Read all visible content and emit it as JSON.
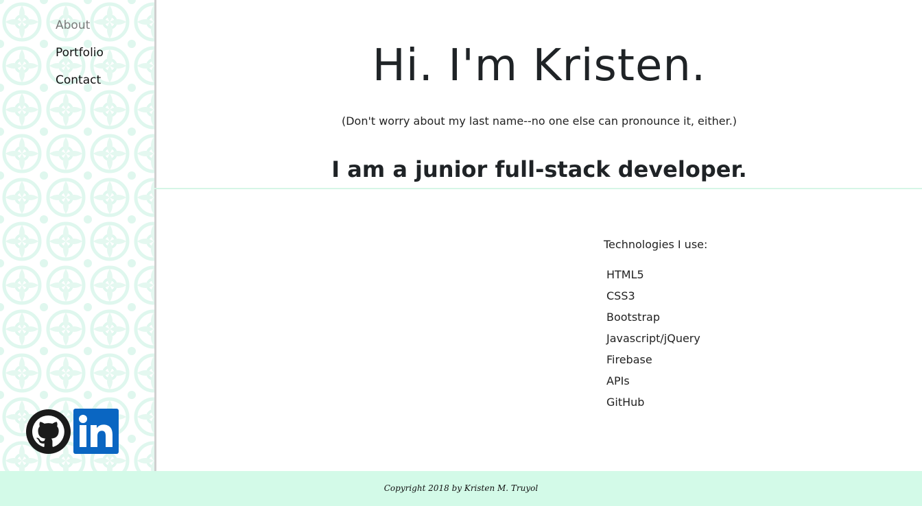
{
  "sidebar": {
    "nav": [
      {
        "label": "About",
        "active": true
      },
      {
        "label": "Portfolio",
        "active": false
      },
      {
        "label": "Contact",
        "active": false
      }
    ],
    "social": [
      {
        "icon": "github-icon"
      },
      {
        "icon": "linkedin-icon"
      }
    ]
  },
  "hero": {
    "title": "Hi. I'm Kristen.",
    "subtitle": "(Don't worry about my last name--no one else can pronounce it, either.)",
    "role": "I am a junior full-stack developer."
  },
  "technologies": {
    "heading": "Technologies I use:",
    "items": [
      "HTML5",
      "CSS3",
      "Bootstrap",
      "Javascript/jQuery",
      "Firebase",
      "APIs",
      "GitHub"
    ]
  },
  "footer": {
    "copyright": "Copyright 2018 by Kristen M. Truyol"
  },
  "colors": {
    "accent_mint": "#d3fae8",
    "pattern_mint": "#dff7ee",
    "linkedin_blue": "#0a66c2",
    "text_dark": "#1f2326",
    "nav_active": "#7a7a7a"
  }
}
